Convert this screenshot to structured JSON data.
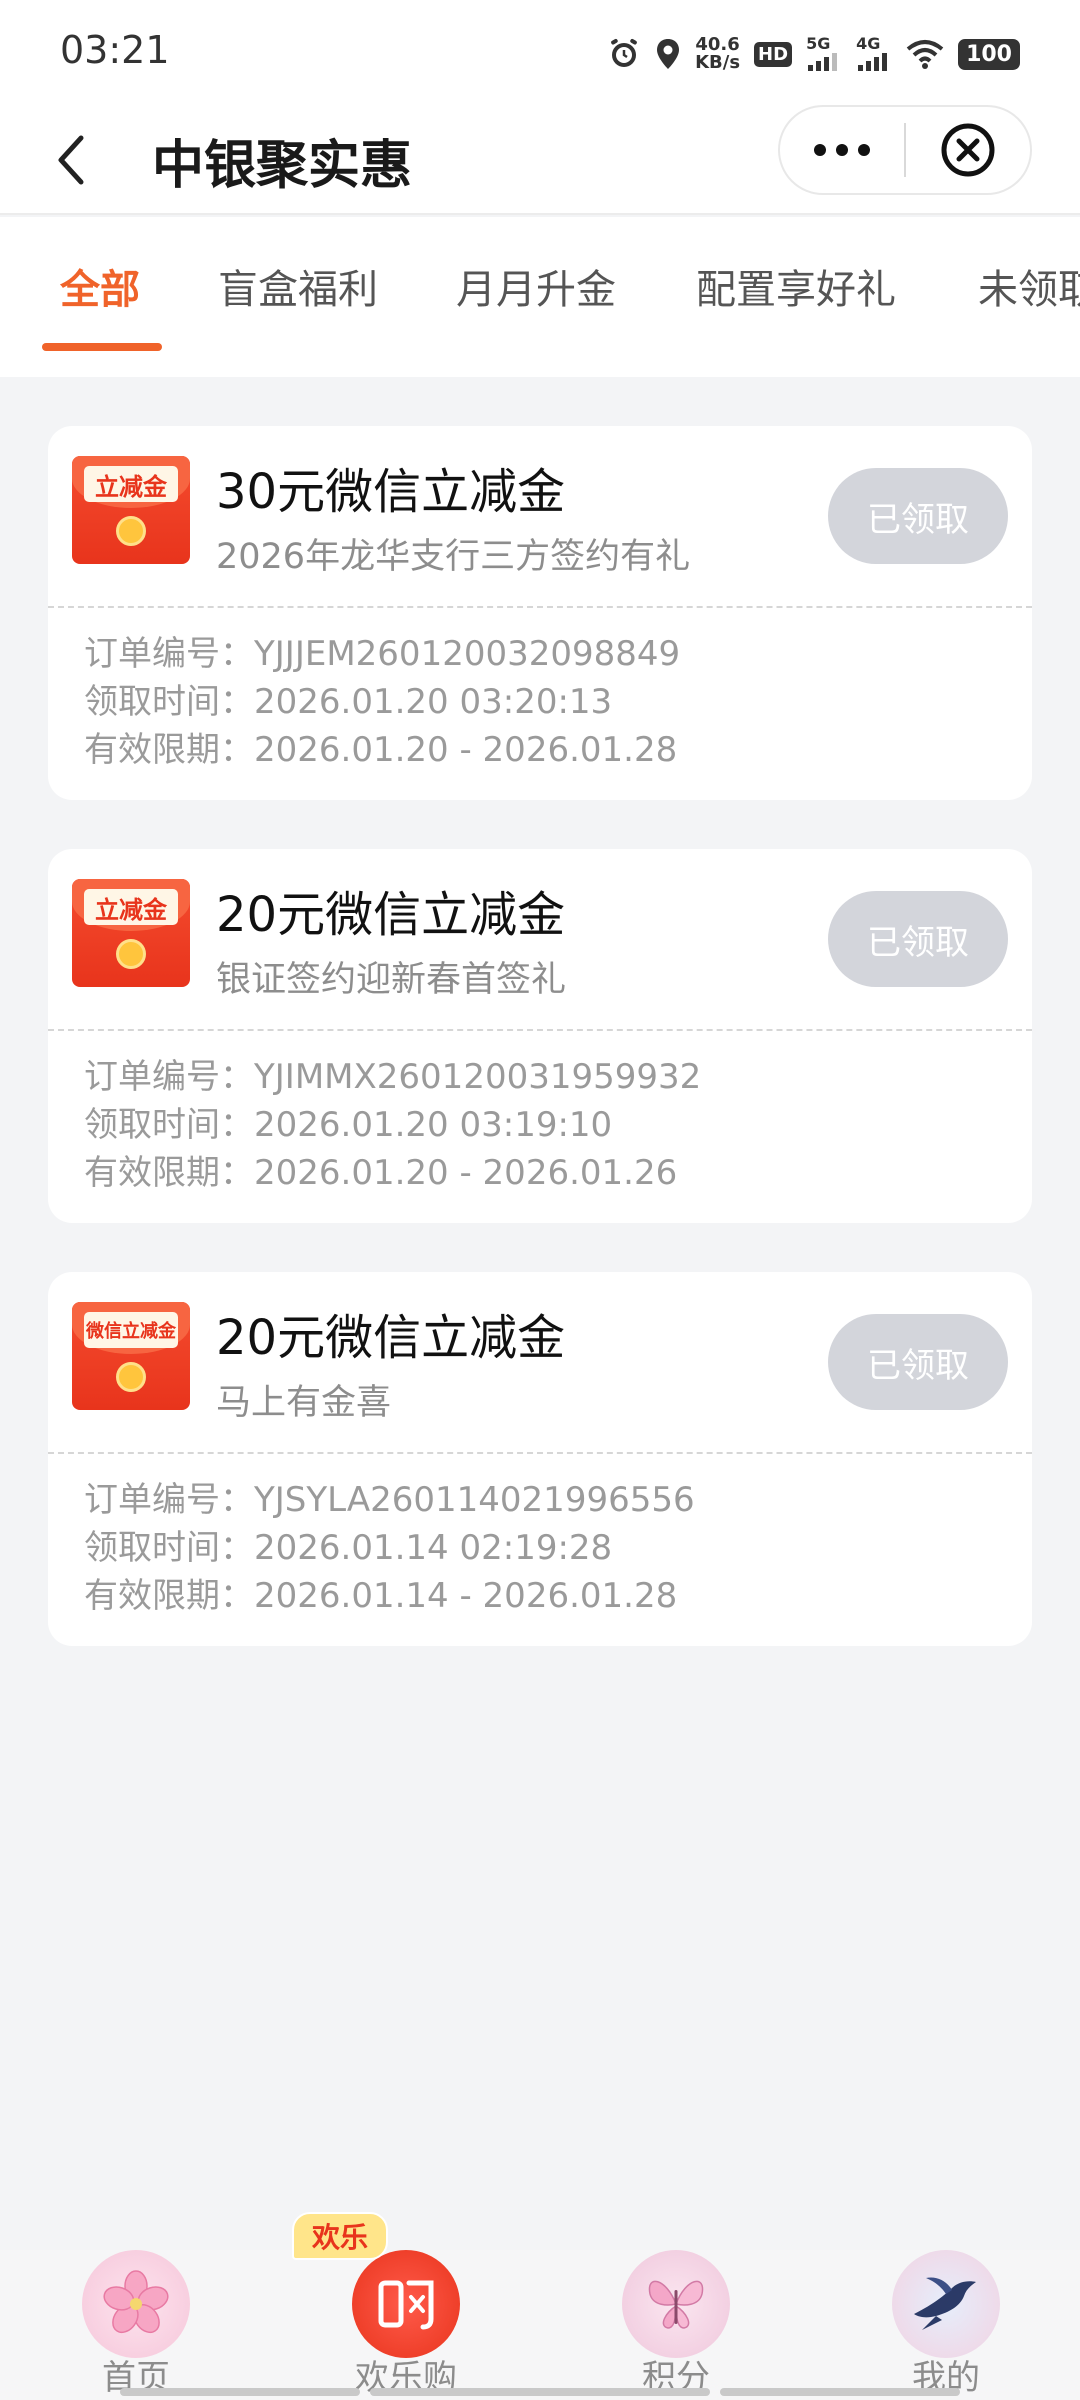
{
  "status_bar": {
    "time": "03:21",
    "net_speed_value": "40.6",
    "net_speed_unit": "KB/s",
    "hd_label": "HD",
    "sim1_label": "5G",
    "sim2_label": "4G",
    "battery": "100"
  },
  "header": {
    "title": "中银聚实惠"
  },
  "tabs": [
    {
      "label": "全部",
      "active": true
    },
    {
      "label": "盲盒福利",
      "active": false
    },
    {
      "label": "月月升金",
      "active": false
    },
    {
      "label": "配置享好礼",
      "active": false
    },
    {
      "label": "未领取",
      "active": false
    }
  ],
  "cards": [
    {
      "envelope_label": "立减金",
      "title": "30元微信立减金",
      "subtitle": "2026年龙华支行三方签约有礼",
      "button": "已领取",
      "order_label": "订单编号：",
      "order_no": "YJJJEM260120032098849",
      "time_label": "领取时间：",
      "claim_time": "2026.01.20 03:20:13",
      "valid_label": "有效限期：",
      "valid_period": "2026.01.20 - 2026.01.28"
    },
    {
      "envelope_label": "立减金",
      "title": "20元微信立减金",
      "subtitle": "银证签约迎新春首签礼",
      "button": "已领取",
      "order_label": "订单编号：",
      "order_no": "YJIMMX260120031959932",
      "time_label": "领取时间：",
      "claim_time": "2026.01.20 03:19:10",
      "valid_label": "有效限期：",
      "valid_period": "2026.01.20 - 2026.01.26"
    },
    {
      "envelope_label": "微信立减金",
      "title": "20元微信立减金",
      "subtitle": "马上有金喜",
      "button": "已领取",
      "order_label": "订单编号：",
      "order_no": "YJSYLA260114021996556",
      "time_label": "领取时间：",
      "claim_time": "2026.01.14 02:19:28",
      "valid_label": "有效限期：",
      "valid_period": "2026.01.14 - 2026.01.28"
    }
  ],
  "bottom_nav": {
    "badge": "欢乐",
    "items": [
      {
        "label": "首页",
        "icon": "cherry-blossom-icon"
      },
      {
        "label": "欢乐购",
        "icon": "shopping-bag-icon"
      },
      {
        "label": "积分",
        "icon": "butterfly-icon"
      },
      {
        "label": "我的",
        "icon": "swallow-icon"
      }
    ]
  },
  "colors": {
    "accent": "#f0632a",
    "claimed_button": "#d3d5db",
    "envelope_red": "#e8341c"
  }
}
